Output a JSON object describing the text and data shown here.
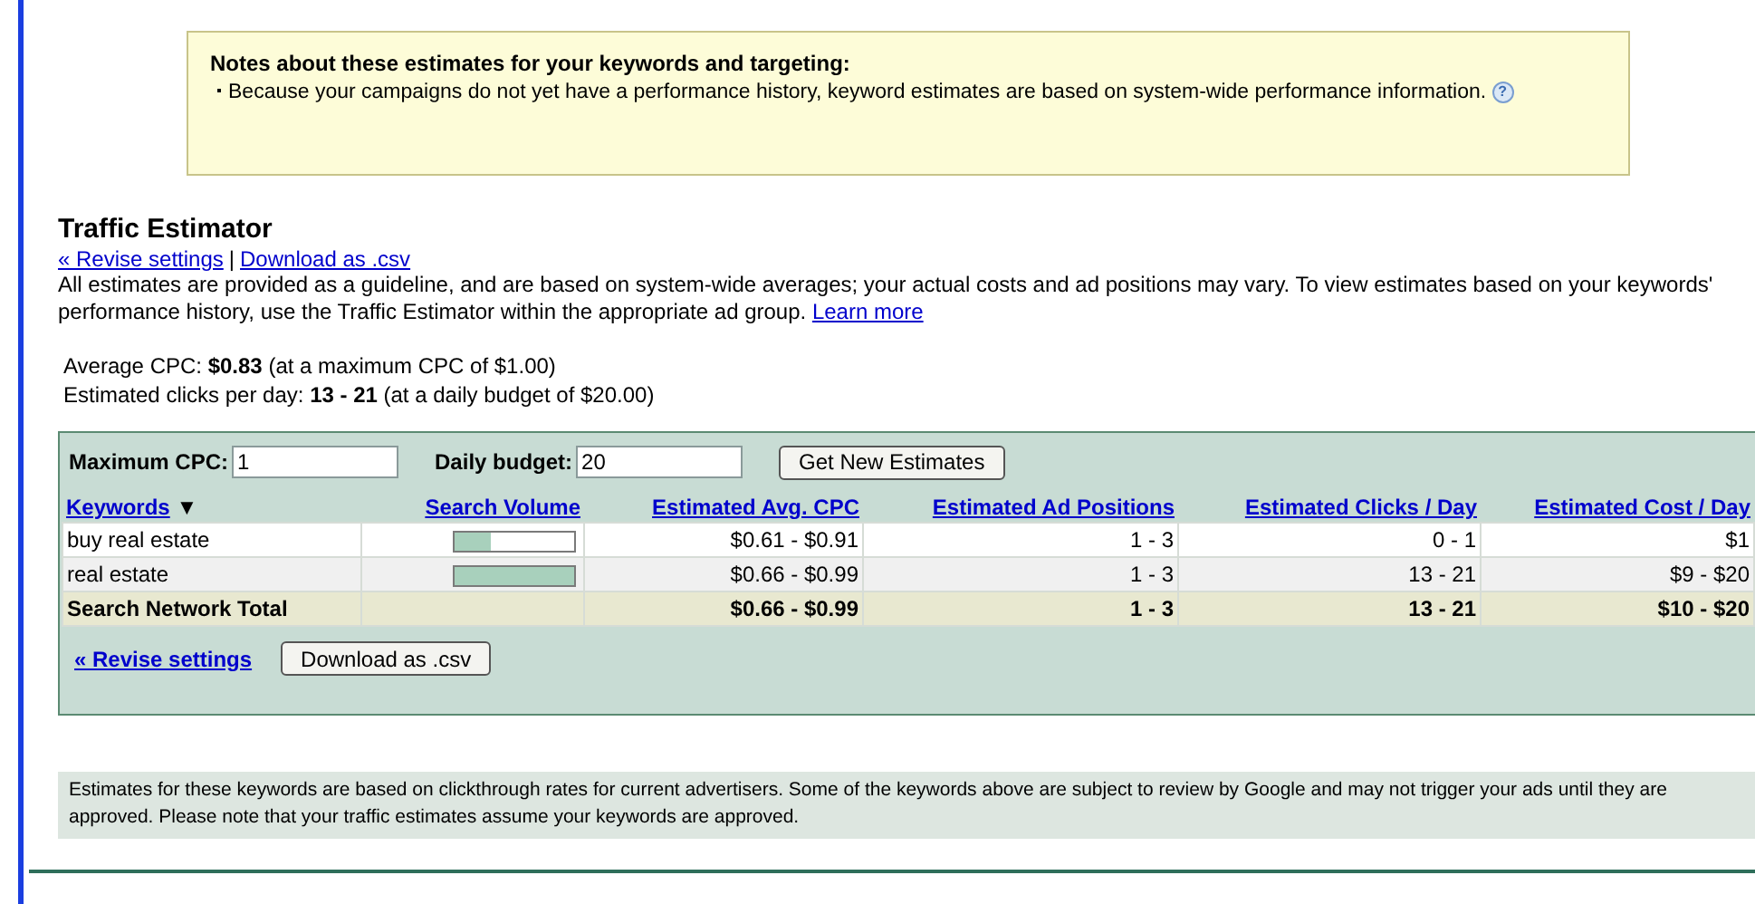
{
  "notes": {
    "title": "Notes about these estimates for your keywords and targeting:",
    "items": [
      "Because your campaigns do not yet have a performance history, keyword estimates are based on system-wide performance information."
    ],
    "help_icon": "?"
  },
  "title": "Traffic Estimator",
  "links": [
    "« Revise settings",
    "Download as .csv"
  ],
  "separator": "|",
  "description": "All estimates are provided as a guideline, and are based on system-wide averages; your actual costs and ad positions may vary. To view estimates based on your keywords' performance history, use the Traffic Estimator within the appropriate ad group.",
  "learn_more": "Learn more",
  "summary": [
    "Average CPC: **$0.83** (at a maximum CPC of $1.00)",
    "Estimated clicks per day: **13 - 21** (at a daily budget of $20.00)"
  ],
  "form": {
    "max_cpc_label": "Maximum CPC:",
    "max_cpc_value": "1",
    "budget_label": "Daily budget:",
    "budget_value": "20",
    "button": "Get New Estimates"
  },
  "table": {
    "columns": [
      "Keywords",
      "Search Volume",
      "Estimated Avg. CPC",
      "Estimated Ad Positions",
      "Estimated Clicks / Day",
      "Estimated Cost / Day"
    ],
    "sort_indicator": "▼",
    "rows": [
      {
        "keyword": "buy real estate",
        "level": 0.3,
        "cpc": "$0.61 - $0.91",
        "positions": "1 - 3",
        "clicks": "0 - 1",
        "cost": "$1"
      },
      {
        "keyword": "real estate",
        "level": 1,
        "cpc": "$0.66 - $0.99",
        "positions": "1 - 3",
        "clicks": "13 - 21",
        "cost": "$9 - $20"
      }
    ],
    "total": {
      "label": "Search Network Total",
      "cpc": "$0.66 - $0.99",
      "positions": "1 - 3",
      "clicks": "13 - 21",
      "cost": "$10 - $20"
    }
  },
  "bottom": {
    "link": "« Revise settings",
    "button": "Download as .csv"
  },
  "footnote": "Estimates for these keywords are based on clickthrough rates for current advertisers. Some of the keywords above are subject to review by Google and may not trigger your ads until they are approved. Please note that your traffic estimates assume your keywords are approved."
}
